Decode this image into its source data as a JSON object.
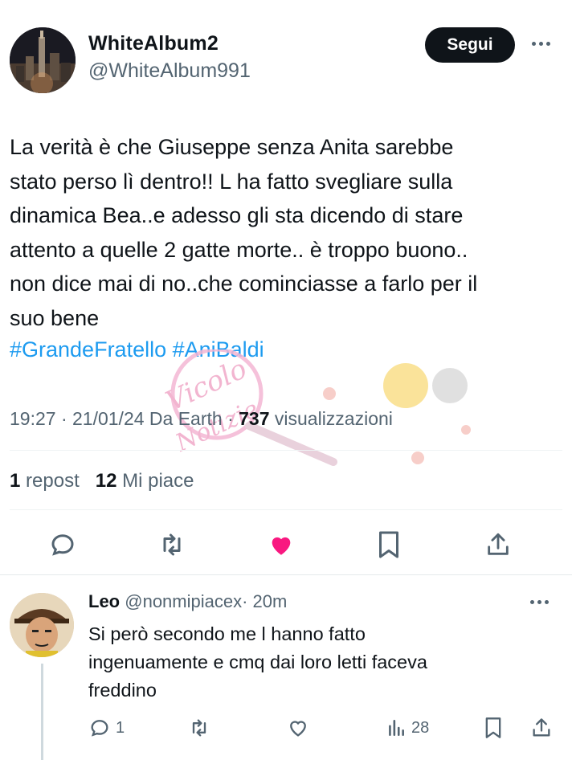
{
  "author": {
    "name": "WhiteAlbum2",
    "handle": "@WhiteAlbum991",
    "follow_label": "Segui"
  },
  "tweet": {
    "text": "La verità è che Giuseppe senza Anita sarebbe\nstato perso lì dentro!! L ha fatto svegliare sulla\ndinamica Bea..e adesso gli sta dicendo di stare\nattento a quelle 2 gatte morte.. è troppo buono..\nnon dice mai di no..che cominciasse a farlo per il\nsuo bene",
    "hashtags": "#GrandeFratello #AniBaldi",
    "time": "19:27 · 21/01/24 Da Earth ·",
    "views_count": "737",
    "views_label": "visualizzazioni",
    "reposts_count": "1",
    "reposts_label": "repost",
    "likes_count": "12",
    "likes_label": "Mi piace"
  },
  "actions": {
    "reply_icon": "reply-icon",
    "repost_icon": "repost-icon",
    "like_icon": "heart-filled-icon",
    "like_color": "#f91880",
    "bookmark_icon": "bookmark-icon",
    "share_icon": "share-icon"
  },
  "reply": {
    "name": "Leo",
    "handle": "@nonmipiacex",
    "time": "· 20m",
    "text": "Si però secondo me l hanno fatto\ningenuamente e cmq dai loro letti faceva\nfreddino",
    "reply_count": "1",
    "views_count": "28"
  },
  "colors": {
    "text": "#0f1419",
    "secondary": "#536471",
    "link": "#1d9bf0",
    "follow_bg": "#0f1419"
  }
}
